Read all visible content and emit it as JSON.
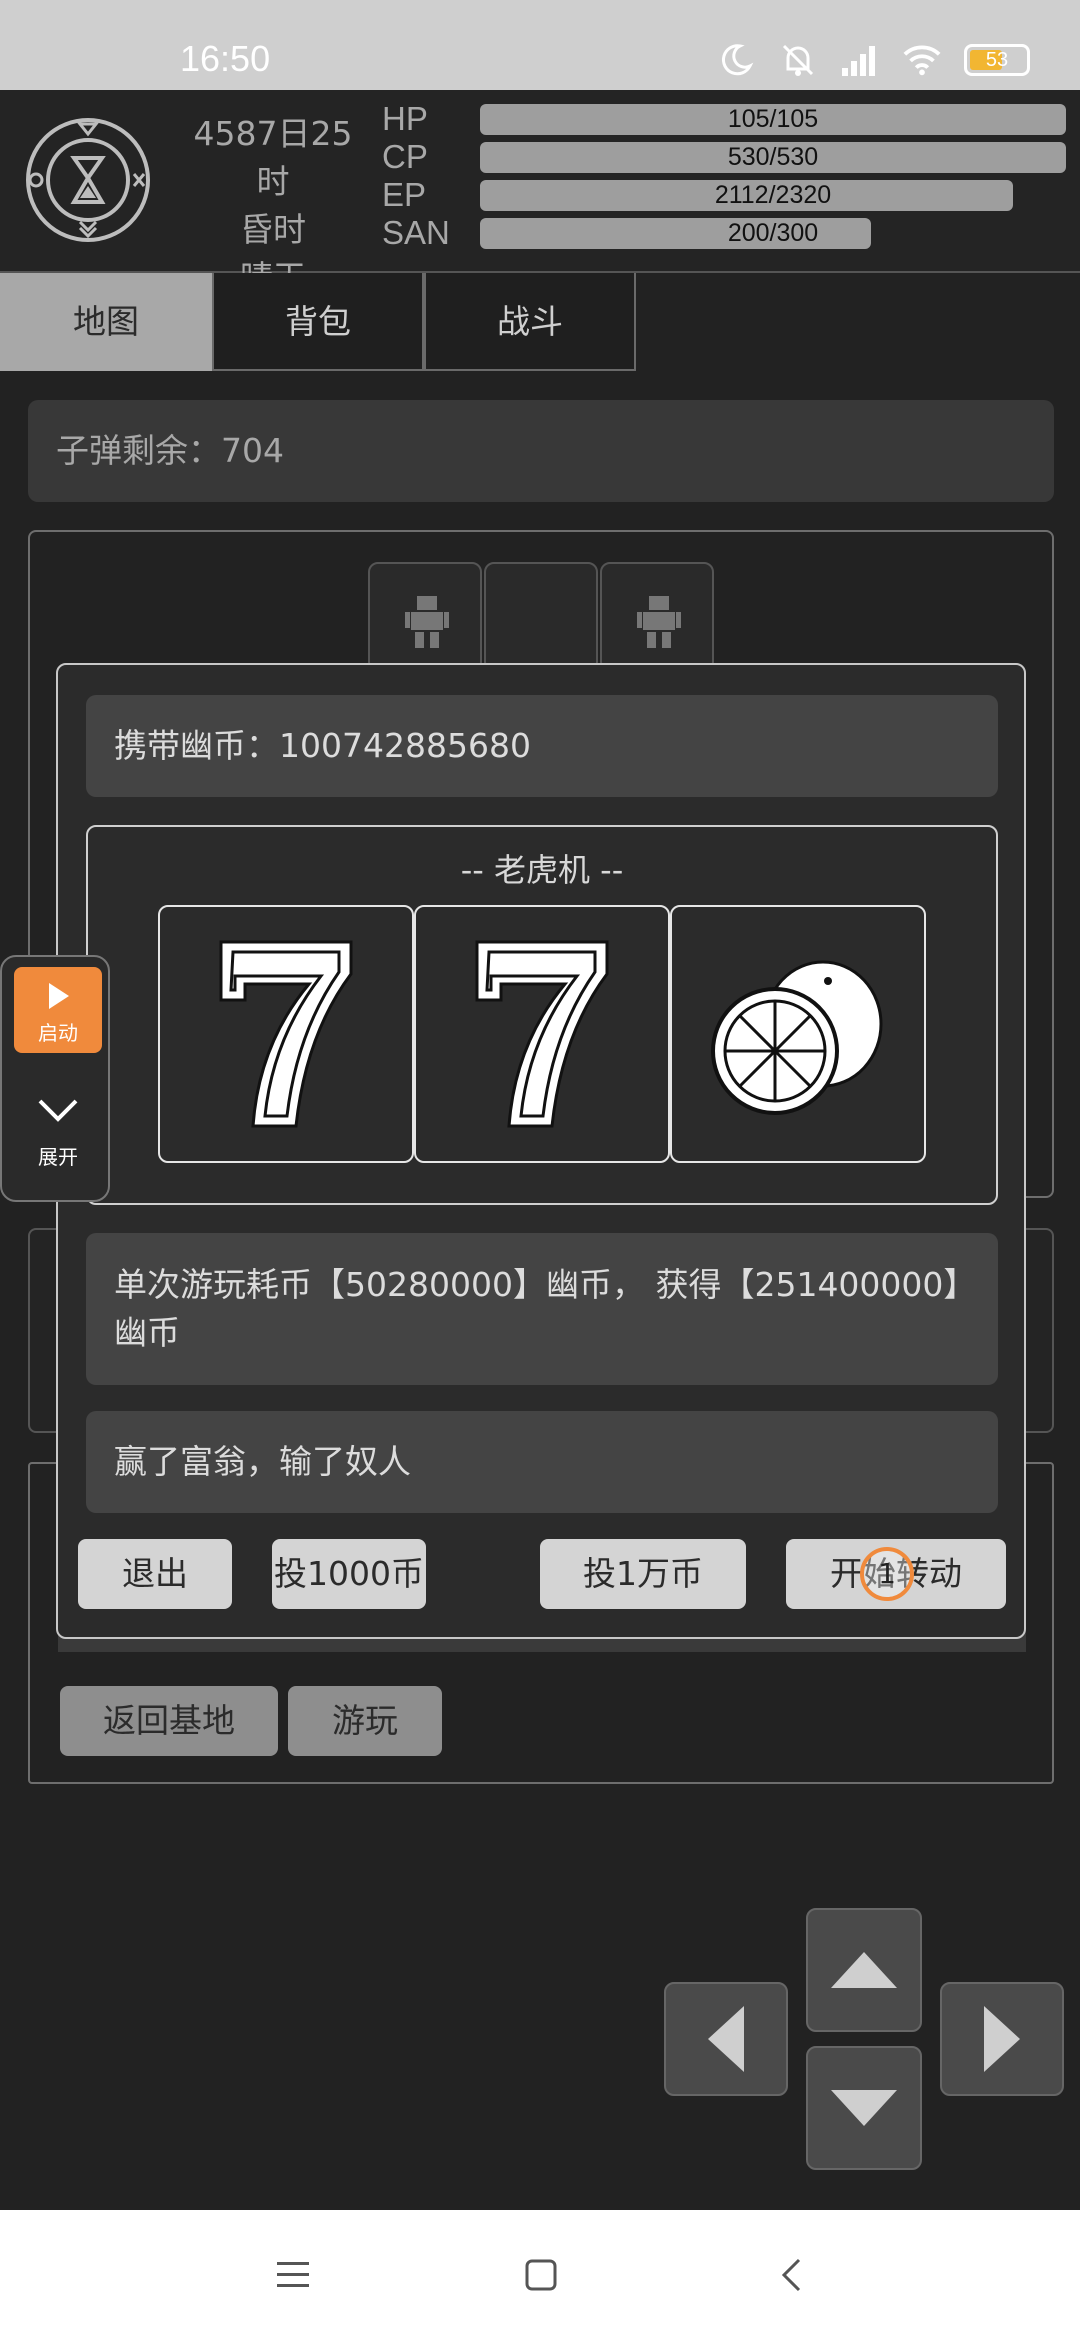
{
  "status_bar": {
    "time": "16:50",
    "battery": "53",
    "icons": [
      "moon-icon",
      "bell-off-icon",
      "signal-icon",
      "wifi-icon",
      "battery-icon"
    ]
  },
  "header": {
    "date_time": "4587日25时",
    "period": "昏时",
    "weather": "晴天",
    "stats": [
      {
        "label": "HP",
        "text": "105/105",
        "fraction": 1.0
      },
      {
        "label": "CP",
        "text": "530/530",
        "fraction": 1.0
      },
      {
        "label": "EP",
        "text": "2112/2320",
        "fraction": 0.91
      },
      {
        "label": "SAN",
        "text": "200/300",
        "fraction": 0.667
      }
    ]
  },
  "tabs": [
    "地图",
    "背包",
    "战斗"
  ],
  "bullets_text": "子弹剩余：704",
  "dialog": {
    "coins_text": "携带幽币：100742885680",
    "slot_title": "-- 老虎机 --",
    "reels": [
      "7",
      "7",
      "lemon"
    ],
    "info_text": "单次游玩耗币【50280000】幽币， 获得【251400000】幽币",
    "motto": "赢了富翁，输了奴人",
    "buttons": {
      "exit": "退出",
      "bet_1000": "投1000币",
      "bet_10000": "投1万币",
      "spin": "开始转动"
    },
    "touch_marker": "1"
  },
  "lower_buttons": {
    "return_base": "返回基地",
    "play": "游玩"
  },
  "float_widget": {
    "start": "启动",
    "expand": "展开"
  },
  "colors": {
    "background": "#222222",
    "accent_orange": "#f08a3c",
    "bar_fill": "#9e9e9e"
  }
}
